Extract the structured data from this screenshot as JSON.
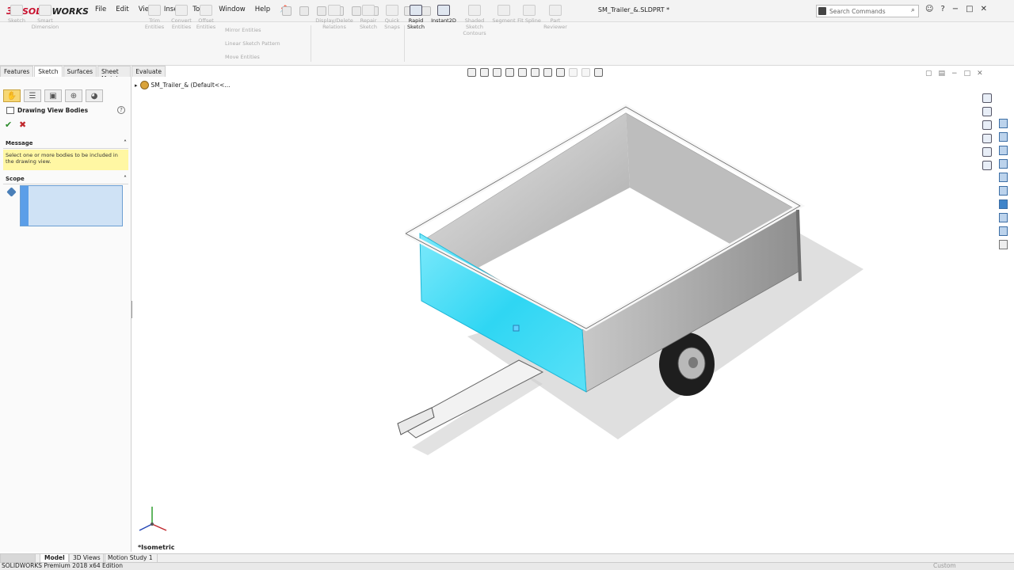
{
  "app": {
    "logo_ds": "3S",
    "logo_solid": "SOLID",
    "logo_works": "WORKS",
    "document_title": "SM_Trailer_&.SLDPRT *",
    "search_placeholder": "Search Commands"
  },
  "menus": [
    "File",
    "Edit",
    "View",
    "Insert",
    "Tools",
    "Window",
    "Help"
  ],
  "command_manager": {
    "tools": [
      {
        "label": "Sketch",
        "enabled": false
      },
      {
        "label": "Smart Dimension",
        "enabled": false
      },
      {
        "label": "Trim Entities",
        "enabled": false
      },
      {
        "label": "Convert Entities",
        "enabled": false
      },
      {
        "label": "Offset Entities",
        "enabled": false
      },
      {
        "label": "Display/Delete Relations",
        "enabled": false
      },
      {
        "label": "Repair Sketch",
        "enabled": false
      },
      {
        "label": "Quick Snaps",
        "enabled": false
      },
      {
        "label": "Rapid Sketch",
        "enabled": true
      },
      {
        "label": "Instant2D",
        "enabled": true
      },
      {
        "label": "Shaded Sketch Contours",
        "enabled": false
      },
      {
        "label": "Segment",
        "enabled": false
      },
      {
        "label": "Fit Spline",
        "enabled": false
      },
      {
        "label": "Part Reviewer",
        "enabled": false
      }
    ],
    "small_tools": [
      "Mirror Entities",
      "Linear Sketch Pattern",
      "Move Entities"
    ]
  },
  "tabs": [
    {
      "label": "Features",
      "active": false
    },
    {
      "label": "Sketch",
      "active": true
    },
    {
      "label": "Surfaces",
      "active": false
    },
    {
      "label": "Sheet Metal",
      "active": false
    },
    {
      "label": "Evaluate",
      "active": false
    }
  ],
  "property_manager": {
    "title": "Drawing View Bodies",
    "message_header": "Message",
    "message": "Select one or more bodies to be included in the drawing view.",
    "scope_header": "Scope"
  },
  "tree": {
    "root_label": "SM_Trailer_& (Default<<..."
  },
  "graphics": {
    "view_orientation": "*Isometric",
    "highlight_color": "#35d6f2"
  },
  "bottom_tabs": [
    {
      "label": "Model",
      "active": true
    },
    {
      "label": "3D Views",
      "active": false
    },
    {
      "label": "Motion Study 1",
      "active": false
    }
  ],
  "status": {
    "text": "SOLIDWORKS Premium 2018 x64 Edition",
    "units": "Custom"
  }
}
